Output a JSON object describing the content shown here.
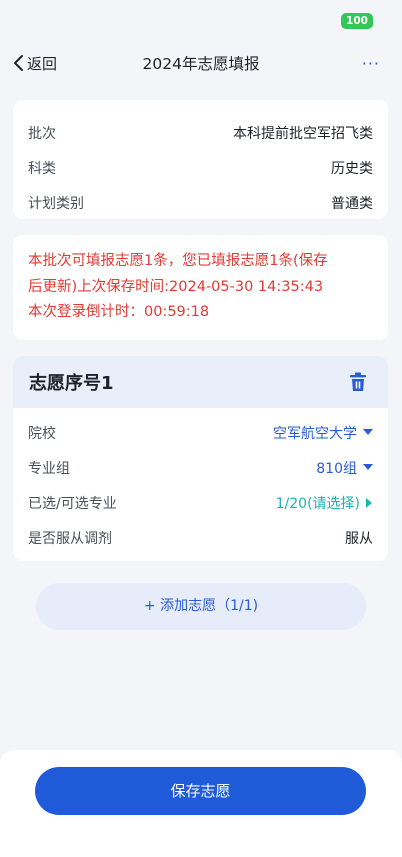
{
  "status": {
    "battery": "100"
  },
  "nav": {
    "back_label": "返回",
    "title": "2024年志愿填报",
    "more_label": "···"
  },
  "info": {
    "rows": [
      {
        "label": "批次",
        "value": "本科提前批空军招飞类"
      },
      {
        "label": "科类",
        "value": "历史类"
      },
      {
        "label": "计划类别",
        "value": "普通类"
      }
    ]
  },
  "notice": {
    "line1": "本批次可填报志愿1条，您已填报志愿1条(保存",
    "line2": "后更新)上次保存时间:2024-05-30 14:35:43",
    "line3": "本次登录倒计时：00:59:18"
  },
  "volunteer": {
    "title": "志愿序号1",
    "rows": [
      {
        "label": "院校",
        "value": "空军航空大学"
      },
      {
        "label": "专业组",
        "value": "810组"
      },
      {
        "label": "已选/可选专业",
        "value": "1/20(请选择)"
      },
      {
        "label": "是否服从调剂",
        "value": "服从"
      }
    ]
  },
  "add_button": "+ 添加志愿（1/1)",
  "save_button": "保存志愿",
  "colors": {
    "accent": "#1f5bd9",
    "danger": "#e03b35",
    "teal": "#1fb2b2",
    "battery": "#33c759"
  }
}
